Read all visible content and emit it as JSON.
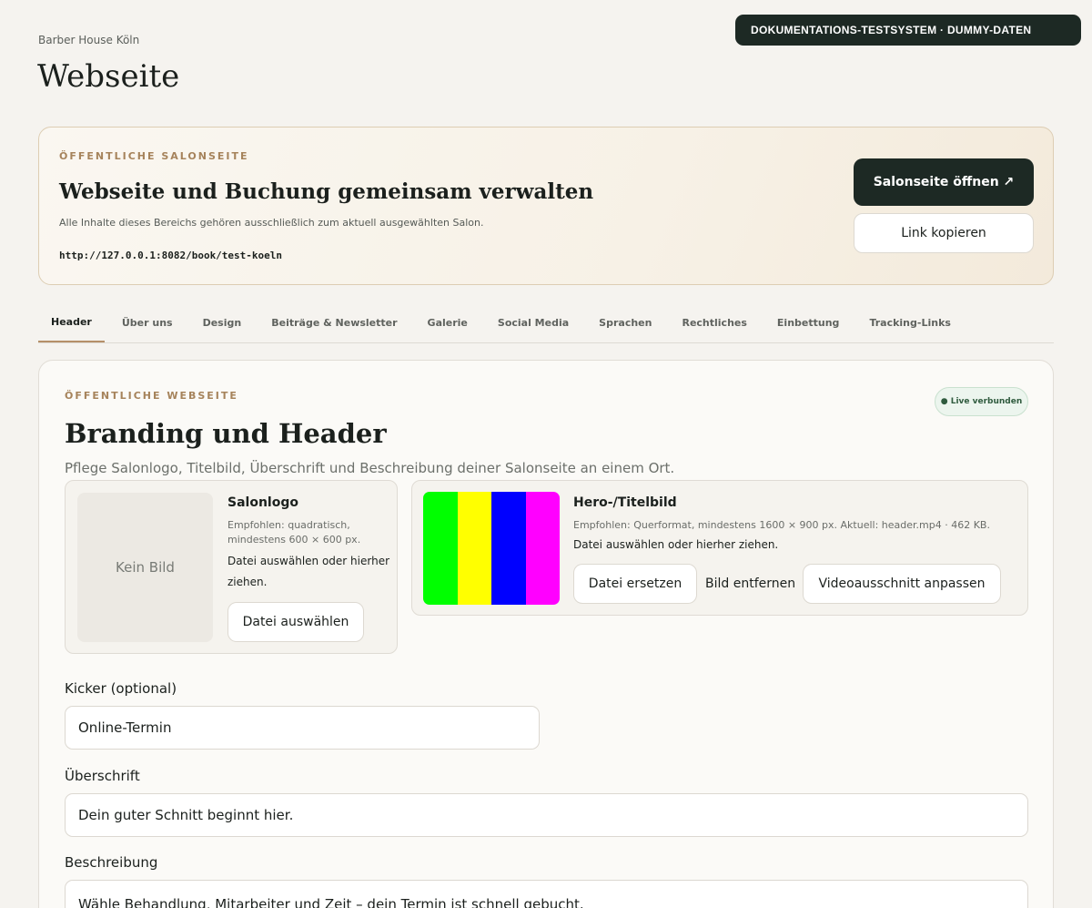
{
  "env_badge": "DOKUMENTATIONS-TESTSYSTEM · DUMMY-DATEN",
  "breadcrumb": "Barber House Köln",
  "page_title": "Webseite",
  "hero": {
    "kicker": "ÖFFENTLICHE SALONSEITE",
    "heading": "Webseite und Buchung gemeinsam verwalten",
    "description": "Alle Inhalte dieses Bereichs gehören ausschließlich zum aktuell ausgewählten Salon.",
    "url": "http://127.0.0.1:8082/book/test-koeln",
    "open_button": "Salonseite öffnen ↗",
    "copy_button": "Link kopieren"
  },
  "tabs": [
    {
      "label": "Header",
      "active": true
    },
    {
      "label": "Über uns"
    },
    {
      "label": "Design"
    },
    {
      "label": "Beiträge & Newsletter"
    },
    {
      "label": "Galerie"
    },
    {
      "label": "Social Media"
    },
    {
      "label": "Sprachen"
    },
    {
      "label": "Rechtliches"
    },
    {
      "label": "Einbettung"
    },
    {
      "label": "Tracking-Links"
    }
  ],
  "section": {
    "kicker": "ÖFFENTLICHE WEBSEITE",
    "status_badge": "● Live verbunden",
    "title": "Branding und Header",
    "description": "Pflege Salonlogo, Titelbild, Überschrift und Beschreibung deiner Salonseite an einem Ort."
  },
  "logo": {
    "placeholder": "Kein Bild",
    "title": "Salonlogo",
    "hint_line1": "Empfohlen: quadratisch,",
    "hint_line2": "mindestens 600 × 600 px.",
    "drop_line1": "Datei auswählen oder hierher",
    "drop_line2": "ziehen.",
    "select_button": "Datei auswählen"
  },
  "hero_image": {
    "title": "Hero-/Titelbild",
    "hint": "Empfohlen: Querformat, mindestens 1600 × 900 px. Aktuell: header.mp4 · 462 KB.",
    "drop": "Datei auswählen oder hierher ziehen.",
    "replace_button": "Datei ersetzen",
    "remove_button": "Bild entfernen",
    "crop_button": "Videoausschnitt anpassen",
    "thumb_colors": [
      "#00ff00",
      "#ffff00",
      "#0000ff",
      "#ff00ff"
    ]
  },
  "fields": {
    "kicker_label": "Kicker (optional)",
    "kicker_value": "Online-Termin",
    "headline_label": "Überschrift",
    "headline_value": "Dein guter Schnitt beginnt hier.",
    "description_label": "Beschreibung",
    "description_value": "Wähle Behandlung, Mitarbeiter und Zeit – dein Termin ist schnell gebucht."
  }
}
